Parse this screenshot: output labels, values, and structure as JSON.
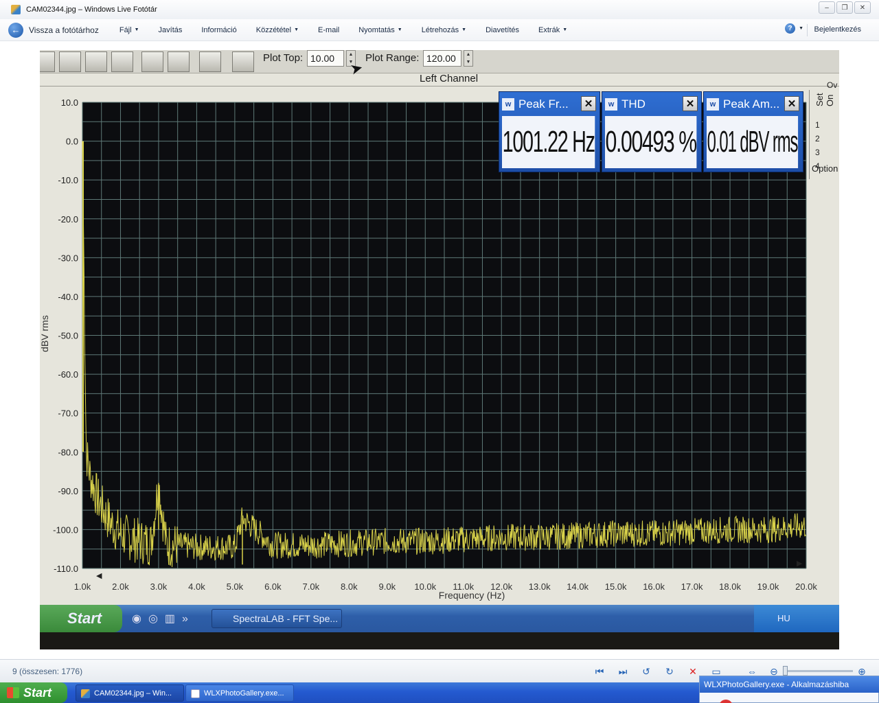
{
  "window": {
    "title": "CAM02344.jpg – Windows Live Fotótár",
    "app_icon": "photo-gallery-icon",
    "buttons": {
      "minimize": "‒",
      "maximize": "❐",
      "close": "✕"
    }
  },
  "menubar": {
    "back_label": "Vissza a fotótárhoz",
    "items": [
      {
        "label": "Fájl",
        "caret": true
      },
      {
        "label": "Javítás",
        "caret": false
      },
      {
        "label": "Információ",
        "caret": false
      },
      {
        "label": "Közzététel",
        "caret": true
      },
      {
        "label": "E-mail",
        "caret": false
      },
      {
        "label": "Nyomtatás",
        "caret": true
      },
      {
        "label": "Létrehozás",
        "caret": true
      },
      {
        "label": "Diavetítés",
        "caret": false
      },
      {
        "label": "Extrák",
        "caret": true
      }
    ],
    "help_icon": "help-icon",
    "signin_label": "Bejelentkezés"
  },
  "photo": {
    "toolbar": {
      "plot_top_label": "Plot Top:",
      "plot_top_value": "10.00",
      "plot_range_label": "Plot Range:",
      "plot_range_value": "120.00"
    },
    "channel_title": "Left Channel",
    "measurements": [
      {
        "title": "Peak Fr...",
        "value": "1001.22 Hz"
      },
      {
        "title": "THD",
        "value": "0.00493 %"
      },
      {
        "title": "Peak Am...",
        "value": "0.01 dBV rms"
      }
    ],
    "side_panel": {
      "set_label": "Set",
      "on_label": "On",
      "numbers": [
        "1",
        "2",
        "3",
        "4"
      ],
      "options_label": "Option",
      "ov_label": "Ov"
    },
    "xp_taskbar": {
      "start_label": "Start",
      "task_label": "SpectraLAB - FFT Spe...",
      "tray_label": "HU"
    }
  },
  "chart_data": {
    "type": "line",
    "title": "Left Channel",
    "xlabel": "Frequency (Hz)",
    "ylabel": "dBV rms",
    "xlim": [
      1000,
      20000
    ],
    "ylim": [
      -110,
      10
    ],
    "x_ticks": [
      "1.0k",
      "2.0k",
      "3.0k",
      "4.0k",
      "5.0k",
      "6.0k",
      "7.0k",
      "8.0k",
      "9.0k",
      "10.0k",
      "11.0k",
      "12.0k",
      "13.0k",
      "14.0k",
      "15.0k",
      "16.0k",
      "17.0k",
      "18.0k",
      "19.0k",
      "20.0k"
    ],
    "y_ticks": [
      "10.0",
      "0.0",
      "-10.0",
      "-20.0",
      "-30.0",
      "-40.0",
      "-50.0",
      "-60.0",
      "-70.0",
      "-80.0",
      "-90.0",
      "-100.0",
      "-110.0"
    ],
    "grid": true,
    "colors": {
      "background": "#0c0d10",
      "grid": "#5f7a78",
      "line": "#d9d24a"
    },
    "series": [
      {
        "values_x": [
          1000,
          1100,
          1200,
          1400,
          1600,
          1800,
          2000,
          2200,
          2500,
          2800,
          3000,
          3200,
          3500,
          4000,
          4500,
          5000,
          5200,
          6000,
          7000,
          8000,
          9000,
          10000,
          11000,
          12000,
          13000,
          14000,
          15000,
          16000,
          17000,
          18000,
          19000,
          20000
        ],
        "values_y": [
          0.0,
          -80.0,
          -86.0,
          -92.0,
          -96.0,
          -99.0,
          -101.0,
          -102.0,
          -103.0,
          -103.5,
          -88.0,
          -104.0,
          -104.0,
          -104.5,
          -104.5,
          -104.5,
          -97.0,
          -104.0,
          -104.0,
          -103.5,
          -103.0,
          -103.0,
          -102.5,
          -102.0,
          -102.0,
          -101.5,
          -101.0,
          -101.0,
          -100.5,
          -100.0,
          -100.0,
          -99.0
        ]
      }
    ]
  },
  "statusbar": {
    "count_label": "9 (összesen: 1776)",
    "icons": [
      "previous-icon",
      "next-icon",
      "rotate-left-icon",
      "rotate-right-icon",
      "delete-icon",
      "slideshow-icon",
      "fit-icon",
      "zoom-out-icon",
      "zoom-in-icon"
    ]
  },
  "taskbar": {
    "start_label": "Start",
    "tasks": [
      {
        "label": "CAM02344.jpg – Win...",
        "icon": "photo-gallery-icon"
      },
      {
        "label": "WLXPhotoGallery.exe...",
        "icon": "window-icon"
      }
    ],
    "balloon_title": "WLXPhotoGallery.exe - Alkalmazáshiba"
  }
}
